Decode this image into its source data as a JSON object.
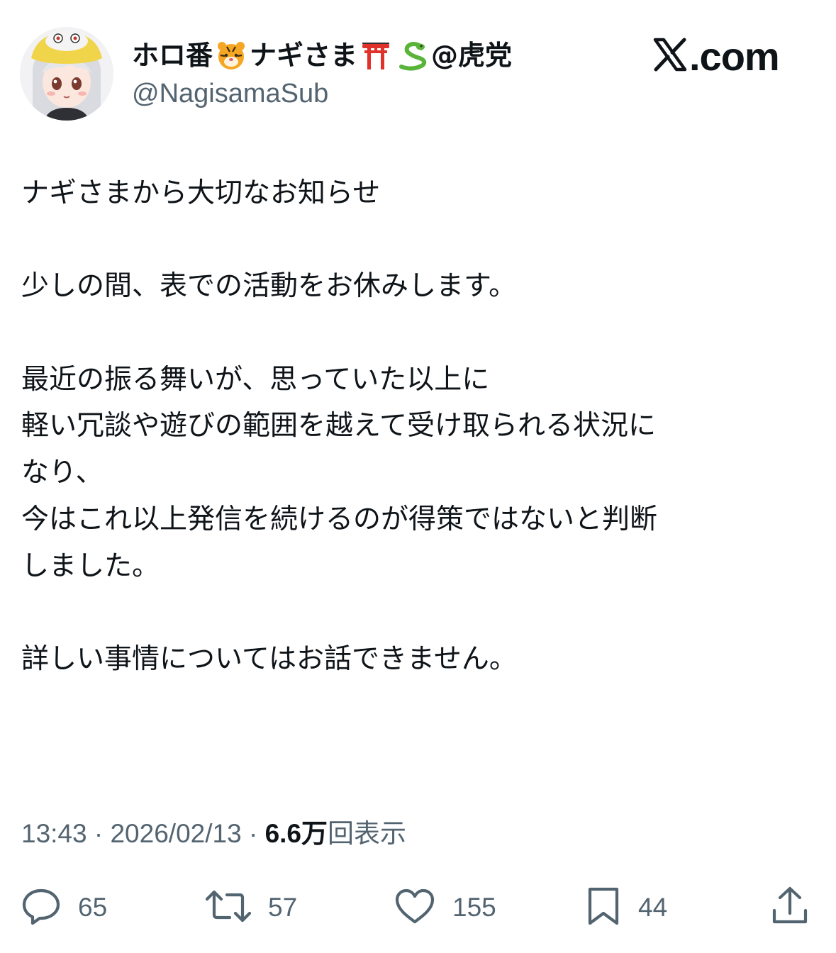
{
  "post": {
    "display_name_part1": "ホロ番",
    "display_name_part2": "ナギさま",
    "display_name_part3": "@虎党",
    "handle": "@NagisamaSub",
    "brand": ".com",
    "body": {
      "line1": "ナギさまから大切なお知らせ",
      "line2": "少しの間、表での活動をお休みします。",
      "line3": "最近の振る舞いが、思っていた以上に",
      "line4": "軽い冗談や遊びの範囲を越えて受け取られる状況に",
      "line5": "なり、",
      "line6": "今はこれ以上発信を続けるのが得策ではないと判断",
      "line7": "しました。",
      "line8": "詳しい事情についてはお話できません。"
    },
    "time": "13:43",
    "separator": "·",
    "date": "2026/02/13",
    "views_value": "6.6",
    "views_unit_man": "万",
    "views_label": "回表示"
  },
  "actions": {
    "replies": "65",
    "reposts": "57",
    "likes": "155",
    "bookmarks": "44"
  },
  "colors": {
    "text": "#0f1419",
    "secondary": "#536471",
    "background": "#ffffff"
  },
  "icons": [
    "tiger-face-icon",
    "torii-gate-icon",
    "snake-icon",
    "x-logo-icon",
    "reply-icon",
    "repost-icon",
    "like-icon",
    "bookmark-icon",
    "share-icon"
  ]
}
